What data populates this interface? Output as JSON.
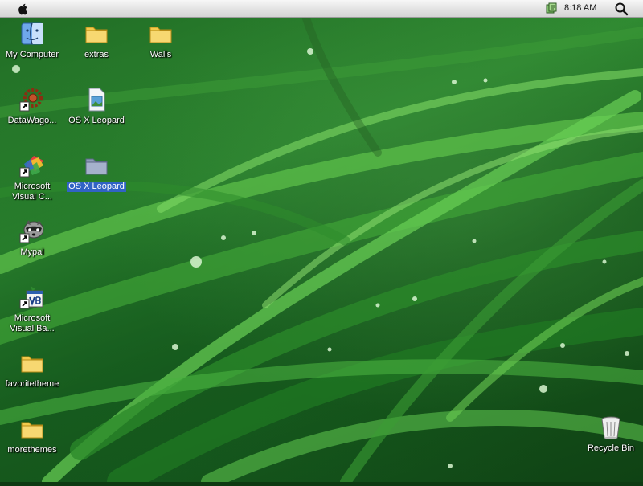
{
  "menubar": {
    "clock": "8:18 AM"
  },
  "desktop": {
    "icons": [
      {
        "label": "My Computer",
        "icon": "finder-icon"
      },
      {
        "label": "extras",
        "icon": "folder-icon"
      },
      {
        "label": "Walls",
        "icon": "folder-icon"
      },
      {
        "label": "DataWago...",
        "icon": "gear-shortcut-icon"
      },
      {
        "label": "OS X Leopard",
        "icon": "image-file-icon"
      },
      {
        "label": "Microsoft Visual C...",
        "icon": "visual-studio-shortcut-icon"
      },
      {
        "label": "OS X Leopard",
        "icon": "folder-icon",
        "selected": true
      },
      {
        "label": "Mypal",
        "icon": "raccoon-shortcut-icon"
      },
      {
        "label": "Microsoft Visual Ba...",
        "icon": "visual-basic-shortcut-icon"
      },
      {
        "label": "favoritetheme",
        "icon": "folder-icon"
      },
      {
        "label": "morethemes",
        "icon": "folder-icon"
      },
      {
        "label": "Recycle Bin",
        "icon": "recycle-bin-icon"
      }
    ]
  },
  "colors": {
    "selection": "#3163c5",
    "folder": "#f2c94c",
    "grass": "#2f8a31"
  }
}
